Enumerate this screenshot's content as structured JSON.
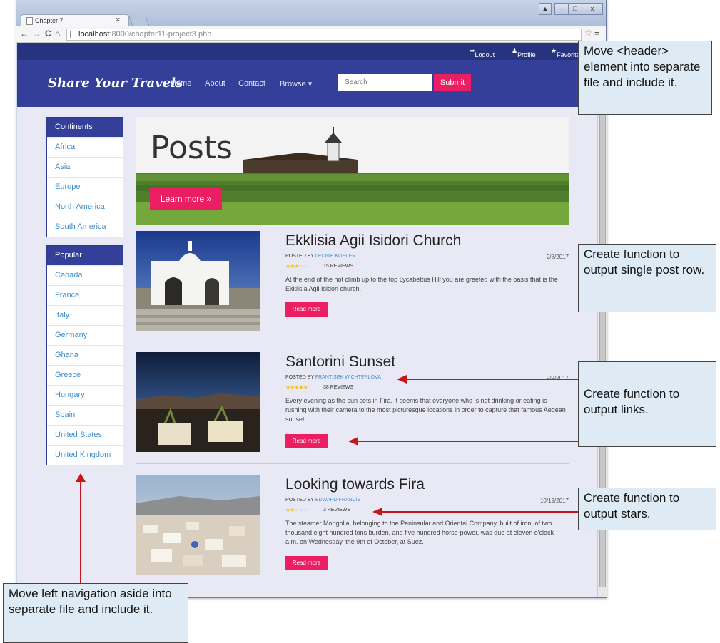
{
  "browser": {
    "tab_title": "Chapter 7",
    "tab_close": "×",
    "window_controls": [
      "▲",
      "–",
      "□",
      "x"
    ],
    "url_host": "localhost",
    "url_path": ":8000/chapter11-project3.php",
    "nav_back": "←",
    "nav_forward": "→",
    "nav_reload": "C",
    "nav_home": "⌂",
    "star": "☆",
    "menu": "≡"
  },
  "topbar": {
    "logout": "Logout",
    "profile": "Profile",
    "favorites": "Favorites"
  },
  "header": {
    "brand": "Share Your Travels",
    "nav": [
      "Home",
      "About",
      "Contact",
      "Browse ▾"
    ],
    "search_placeholder": "Search",
    "submit": "Submit"
  },
  "sidebar": {
    "continents_title": "Continents",
    "continents": [
      "Africa",
      "Asia",
      "Europe",
      "North America",
      "South America"
    ],
    "popular_title": "Popular",
    "popular": [
      "Canada",
      "France",
      "Italy",
      "Germany",
      "Ghana",
      "Greece",
      "Hungary",
      "Spain",
      "United States",
      "United Kingdom"
    ]
  },
  "hero": {
    "title": "Posts",
    "button": "Learn more »"
  },
  "posts": [
    {
      "title": "Ekklisia Agii Isidori Church",
      "posted_by": "POSTED BY ",
      "author": "LEONIE KOHLER",
      "date": "2/8/2017",
      "rating": 3,
      "stars": "★★★★★",
      "reviews": "15 REVIEWS",
      "excerpt": "At the end of the hot climb up to the top Lycabettus Hill you are greeted with the oasis that is the Ekklisia Agii Isidori church.",
      "button": "Read more"
    },
    {
      "title": "Santorini Sunset",
      "posted_by": "POSTED BY ",
      "author": "FRANTISEK WICHTERLOVA",
      "date": "9/9/2017",
      "rating": 5,
      "stars": "★★★★★",
      "reviews": "38 REVIEWS",
      "excerpt": "Every evening as the sun sets in Fira, it seems that everyone who is not drinking or eating is rushing with their camera to the most picturesque locations in order to capture that famous Aegean sunset.",
      "button": "Read more"
    },
    {
      "title": "Looking towards Fira",
      "posted_by": "POSTED BY ",
      "author": "EDWARD FRANCIS",
      "date": "10/19/2017",
      "rating": 2,
      "stars": "★★★★★",
      "reviews": "3 REVIEWS",
      "excerpt": "The steamer Mongolia, belonging to the Peninsular and Oriental Company, built of iron, of two thousand eight hundred tons burden, and five hundred horse-power, was due at eleven o'clock a.m. on Wednesday, the 9th of October, at Suez.",
      "button": "Read more"
    }
  ],
  "annotations": {
    "header_note": "Move <header> element into separate file and include it.",
    "post_row_note": "Create function to output single post row.",
    "links_note": "Create function to output links.",
    "stars_note": "Create function to output stars.",
    "aside_note": "Move left navigation aside into separate file and include it."
  },
  "colors": {
    "header": "#343f99",
    "topbar": "#26337f",
    "accent": "#ec1e63",
    "link": "#3d8fd0",
    "note_bg": "#deebf5",
    "arrow": "#c5161d"
  }
}
